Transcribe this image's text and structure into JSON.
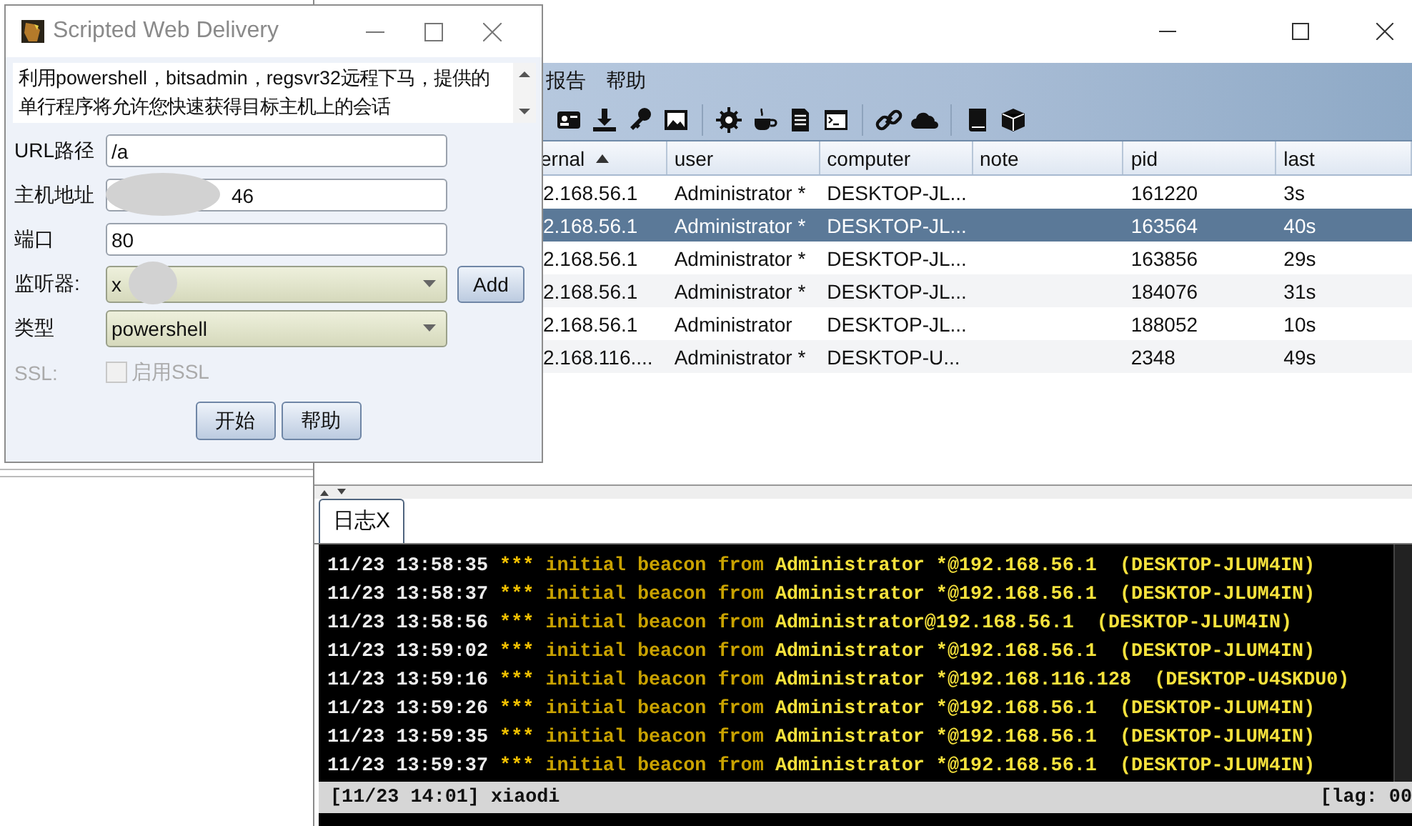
{
  "dialog": {
    "title": "Scripted Web Delivery",
    "description": "利用powershell，bitsadmin，regsvr32远程下马，提供的单行程序将允许您快速获得目标主机上的会话",
    "fields": [
      {
        "kind": "text",
        "label": "URL路径",
        "value": "/a"
      },
      {
        "kind": "text",
        "label": "主机地址",
        "value": "46",
        "redacted": true
      },
      {
        "kind": "text",
        "label": "端口",
        "value": "80"
      },
      {
        "kind": "combo",
        "label": "监听器:",
        "value": "x",
        "redacted": true,
        "button": "Add"
      },
      {
        "kind": "combo",
        "label": "类型",
        "value": "powershell"
      },
      {
        "kind": "checkbox",
        "label": "SSL:",
        "option": "启用SSL",
        "checked": false,
        "disabled": true
      }
    ],
    "buttons": [
      "开始",
      "帮助"
    ]
  },
  "main": {
    "menu": [
      "报告",
      "帮助"
    ],
    "table": {
      "columns": [
        {
          "label": "ernal",
          "sorted": true
        },
        {
          "label": "user",
          "sorted": false
        },
        {
          "label": "computer",
          "sorted": false
        },
        {
          "label": "note",
          "sorted": false
        },
        {
          "label": "pid",
          "sorted": false
        },
        {
          "label": "last",
          "sorted": false
        }
      ],
      "rows": [
        {
          "cells": [
            "2.168.56.1",
            "Administrator *",
            "DESKTOP-JL...",
            "",
            "161220",
            "3s"
          ],
          "selected": false
        },
        {
          "cells": [
            "2.168.56.1",
            "Administrator *",
            "DESKTOP-JL...",
            "",
            "163564",
            "40s"
          ],
          "selected": true
        },
        {
          "cells": [
            "2.168.56.1",
            "Administrator *",
            "DESKTOP-JL...",
            "",
            "163856",
            "29s"
          ],
          "selected": false
        },
        {
          "cells": [
            "2.168.56.1",
            "Administrator *",
            "DESKTOP-JL...",
            "",
            "184076",
            "31s"
          ],
          "selected": false
        },
        {
          "cells": [
            "2.168.56.1",
            "Administrator",
            "DESKTOP-JL...",
            "",
            "188052",
            "10s"
          ],
          "selected": false
        },
        {
          "cells": [
            "2.168.116....",
            "Administrator *",
            "DESKTOP-U...",
            "",
            "2348",
            "49s"
          ],
          "selected": false
        }
      ]
    },
    "tabs": [
      {
        "label": "日志X",
        "selected": true
      }
    ],
    "log_lines": [
      {
        "time": "11/23 13:58:35",
        "marker": "***",
        "event": "initial beacon from",
        "detail": "Administrator *@192.168.56.1  (DESKTOP-JLUM4IN)"
      },
      {
        "time": "11/23 13:58:37",
        "marker": "***",
        "event": "initial beacon from",
        "detail": "Administrator *@192.168.56.1  (DESKTOP-JLUM4IN)"
      },
      {
        "time": "11/23 13:58:56",
        "marker": "***",
        "event": "initial beacon from",
        "detail": "Administrator@192.168.56.1  (DESKTOP-JLUM4IN)"
      },
      {
        "time": "11/23 13:59:02",
        "marker": "***",
        "event": "initial beacon from",
        "detail": "Administrator *@192.168.56.1  (DESKTOP-JLUM4IN)"
      },
      {
        "time": "11/23 13:59:16",
        "marker": "***",
        "event": "initial beacon from",
        "detail": "Administrator *@192.168.116.128  (DESKTOP-U4SKDU0)"
      },
      {
        "time": "11/23 13:59:26",
        "marker": "***",
        "event": "initial beacon from",
        "detail": "Administrator *@192.168.56.1  (DESKTOP-JLUM4IN)"
      },
      {
        "time": "11/23 13:59:35",
        "marker": "***",
        "event": "initial beacon from",
        "detail": "Administrator *@192.168.56.1  (DESKTOP-JLUM4IN)"
      },
      {
        "time": "11/23 13:59:37",
        "marker": "***",
        "event": "initial beacon from",
        "detail": "Administrator *@192.168.56.1  (DESKTOP-JLUM4IN)"
      }
    ],
    "status": {
      "left": "[11/23 14:01] xiaodi",
      "right": "[lag: 00"
    }
  }
}
